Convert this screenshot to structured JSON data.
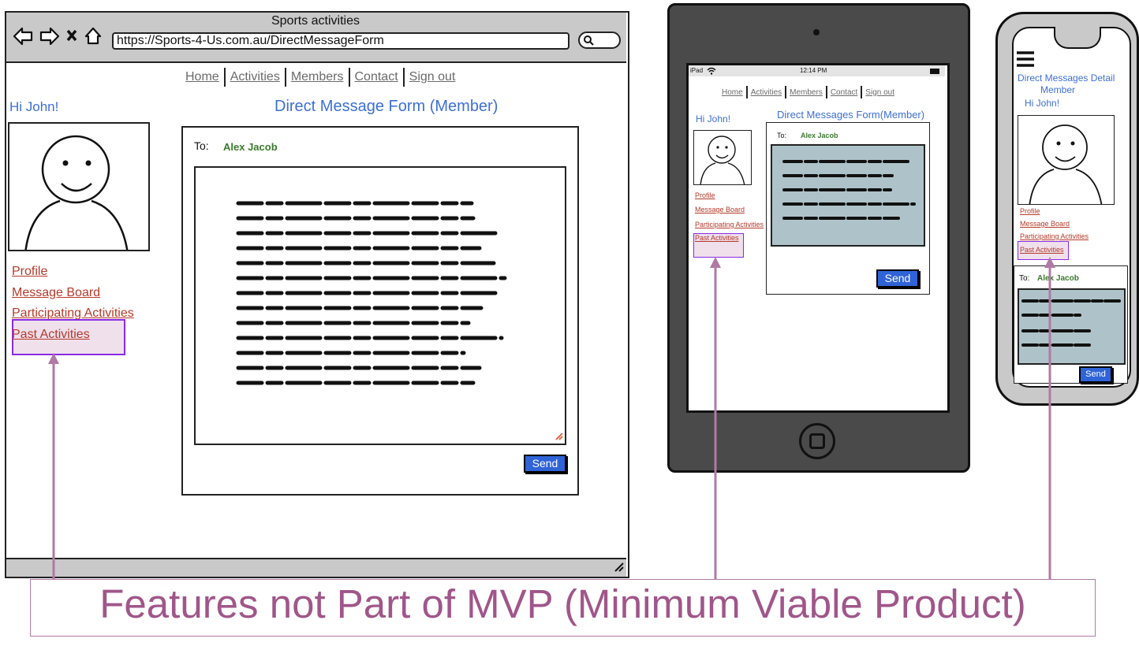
{
  "browser": {
    "window_title": "Sports activities",
    "url": "https://Sports-4-Us.com.au/DirectMessageForm"
  },
  "nav_items": [
    "Home",
    "Activities",
    "Members",
    "Contact",
    "Sign out"
  ],
  "desktop": {
    "greeting": "Hi John!",
    "form_title": "Direct Message Form (Member)",
    "to_label": "To:",
    "recipient": "Alex Jacob",
    "send_label": "Send",
    "sidebar": [
      "Profile",
      "Message Board",
      "Participating Activities",
      "Past Activities"
    ]
  },
  "tablet": {
    "status_left": "iPad",
    "status_time": "12:14 PM",
    "greeting": "Hi John!",
    "form_title": "Direct Messages Form(Member)",
    "to_label": "To:",
    "recipient": "Alex Jacob",
    "send_label": "Send",
    "sidebar": [
      "Profile",
      "Message Board",
      "Participating Activities",
      "Past Activities"
    ]
  },
  "phone": {
    "title_line1": "Direct Messages Detail",
    "title_line2": "Member",
    "greeting": "Hi John!",
    "to_label": "To:",
    "recipient": "Alex Jacob",
    "send_label": "Send",
    "sidebar": [
      "Profile",
      "Message Board",
      "Participating Activities",
      "Past Activities"
    ]
  },
  "annotation": {
    "text": "Features not Part of MVP (Minimum Viable Product)",
    "color": "#a0568a",
    "highlight_fill": "#efe0ec",
    "highlight_border": "#8a2be2"
  }
}
